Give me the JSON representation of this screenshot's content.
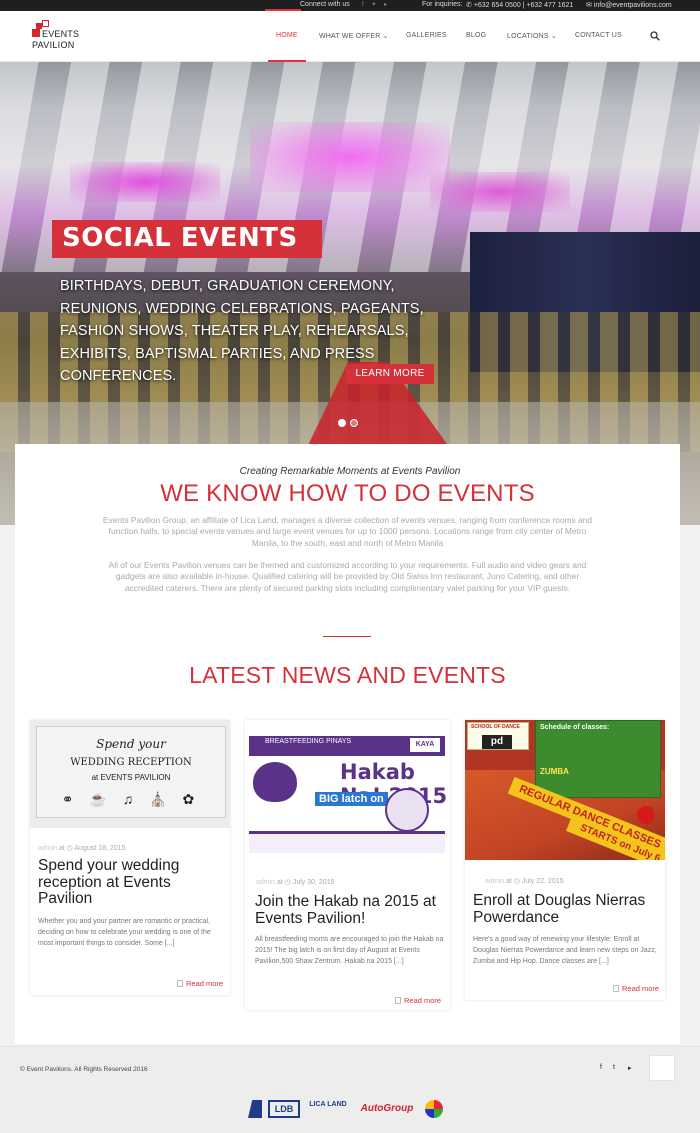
{
  "topbar": {
    "connect": "Connect with us",
    "social": "f  ✦  ▸",
    "inquiries": "For inquiries:",
    "phones": "+632 654 0500 | +632 477 1621",
    "email": "info@eventpavilions.com"
  },
  "header": {
    "logo_line1": "EVENTS",
    "logo_line2": "PAVILION",
    "nav": [
      {
        "label": "HOME",
        "active": true
      },
      {
        "label": "WHAT WE OFFER",
        "caret": "⌄"
      },
      {
        "label": "GALLERIES"
      },
      {
        "label": "BLOG"
      },
      {
        "label": "LOCATIONS",
        "caret": "⌄"
      },
      {
        "label": "CONTACT US"
      }
    ]
  },
  "hero": {
    "badge": "SOCIAL EVENTS",
    "text": "Birthdays, Debut, Graduation Ceremony, Reunions, Wedding Celebrations, Pageants, Fashion Shows, Theater Play, Rehearsals, Exhibits, Baptismal Parties, and Press Conferences.",
    "button": "LEARN MORE",
    "slides": 2,
    "active_slide": 1
  },
  "intro": {
    "tagline": "Creating Remarkable Moments at Events Pavilion",
    "heading": "WE KNOW HOW TO DO EVENTS",
    "paragraph1": "Events Pavilion Group, an affiliate of Lica Land, manages a diverse collection of events venues, ranging from conference rooms and function halls, to special events venues and large event venues for up to 1000 persons. Locations range from city center of Metro Manila, to the south, east and north of Metro Manila",
    "paragraph2": "All of our Events Pavilion venues can be themed and customized according to your requirements. Full audio and video gears and gadgets are also available in-house. Qualified catering will be provided by Old Swiss Inn restaurant, Juno Catering, and other accredited caterers. There are plenty of secured parking slots including complimentary valet parking for your VIP guests."
  },
  "news": {
    "heading": "LATEST NEWS AND EVENTS",
    "read_more": "Read more",
    "items": [
      {
        "author": "admin",
        "date": "August 18, 2015",
        "title": "Spend your wedding reception at Events Pavilion",
        "excerpt": "Whether you and your partner are romantic or practical, deciding on how to celebrate your wedding is one of the most important things to consider. Some [...]",
        "image_line1": "Spend your",
        "image_line2": "WEDDING RECEPTION",
        "image_line3": "at EVENTS PAVILION"
      },
      {
        "author": "admin",
        "date": "July 30, 2015",
        "title": "Join the Hakab na 2015 at Events Pavilion!",
        "excerpt": "All breastfeeding moms are encouraged to join the Hakab na 2015! The big latch is on first day of August at Events Pavilion,500 Shaw Zentrum. Hakab na 2015 [...]",
        "image_title": "Hakab Na! 2015",
        "image_sub": "BIG latch on",
        "image_band": "BREASTFEEDING PINAYS",
        "image_logo": "KAYA"
      },
      {
        "author": "admin",
        "date": "July 22, 2015",
        "title": "Enroll at Douglas Nierras Powerdance",
        "excerpt": "Here's a good way of renewing your lifestyle: Enroll at Douglas Nierras Powerdance and learn new steps on Jazz, Zumba and Hip Hop. Dance classes are [...]",
        "image_board_title": "Schedule of classes:",
        "image_board_zumba": "ZUMBA",
        "image_school": "SCHOOL OF DANCE",
        "image_logo": "pd",
        "image_banner1": "REGULAR DANCE CLASSES",
        "image_banner2": "STARTS on July 6"
      }
    ]
  },
  "footer": {
    "copyright": "© Event Pavilions. All Rights Reserved 2016",
    "social": [
      "f",
      "t",
      "▸"
    ],
    "sponsors": [
      "LDB",
      "LICA LAND",
      "AutoGroup"
    ]
  },
  "colors": {
    "accent": "#d4313a",
    "topbar": "#1f1f1f",
    "footer": "#ededed"
  }
}
